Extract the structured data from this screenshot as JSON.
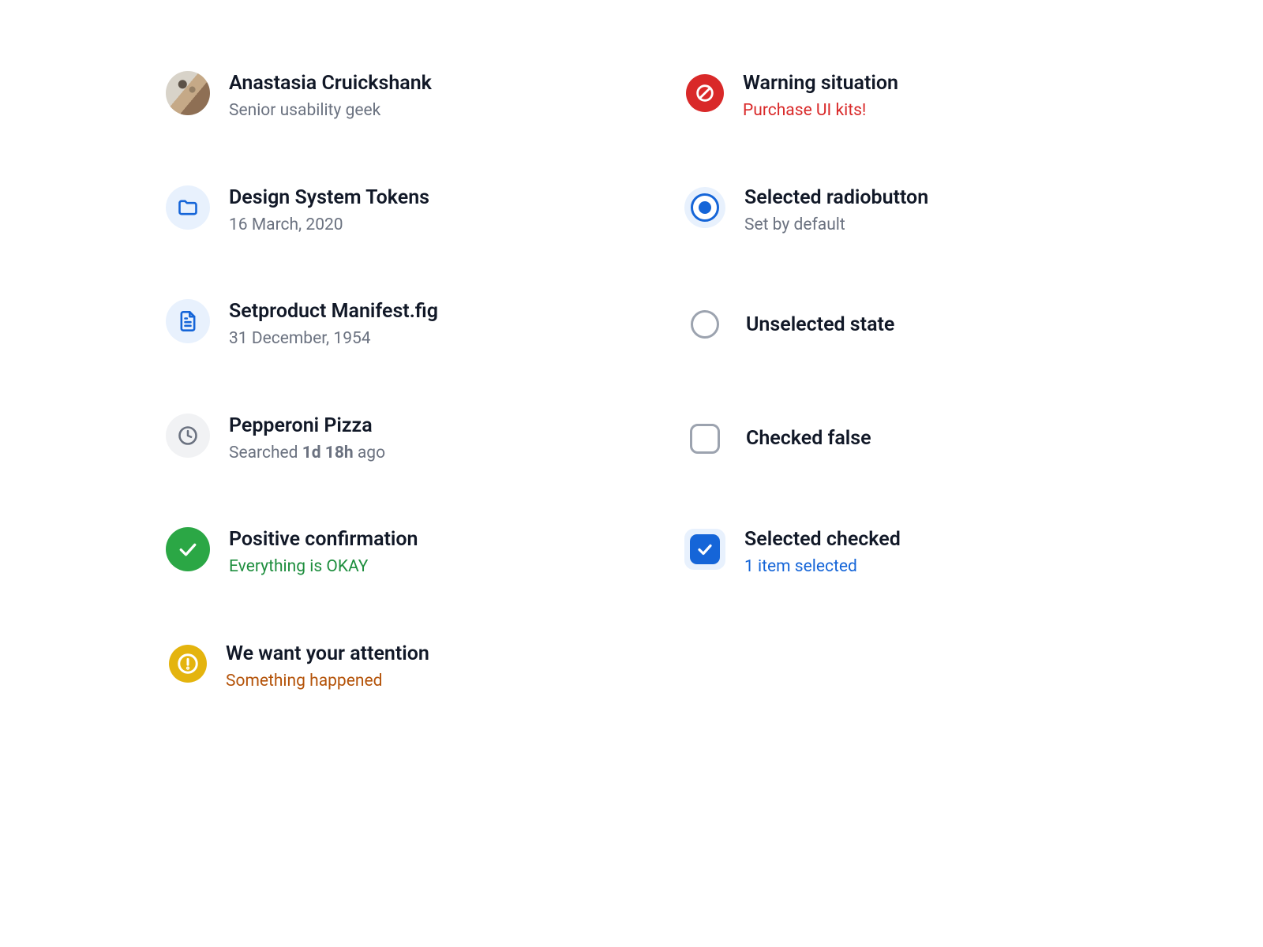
{
  "left": {
    "user": {
      "name": "Anastasia Cruickshank",
      "role": "Senior usability geek"
    },
    "folder": {
      "title": "Design System Tokens",
      "date": "16 March, 2020"
    },
    "file": {
      "title": "Setproduct Manifest.fig",
      "date": "31 December, 1954"
    },
    "search": {
      "title": "Pepperoni Pizza",
      "sub_prefix": "Searched ",
      "sub_bold": "1d 18h",
      "sub_suffix": " ago"
    },
    "positive": {
      "title": "Positive confirmation",
      "sub": "Everything is OKAY"
    },
    "attention": {
      "title": "We want your attention",
      "sub": "Something happened"
    }
  },
  "right": {
    "warning": {
      "title": "Warning situation",
      "sub": "Purchase UI kits!"
    },
    "radio_selected": {
      "title": "Selected radiobutton",
      "sub": "Set by default"
    },
    "radio_unselected": {
      "title": "Unselected state"
    },
    "checkbox_false": {
      "title": "Checked false"
    },
    "checkbox_true": {
      "title": "Selected checked",
      "sub": "1 item selected"
    }
  },
  "colors": {
    "blue": "#1565D8",
    "green": "#2BA745",
    "amber": "#E4B40E",
    "red": "#D92929",
    "gray_text": "#6B7280"
  }
}
